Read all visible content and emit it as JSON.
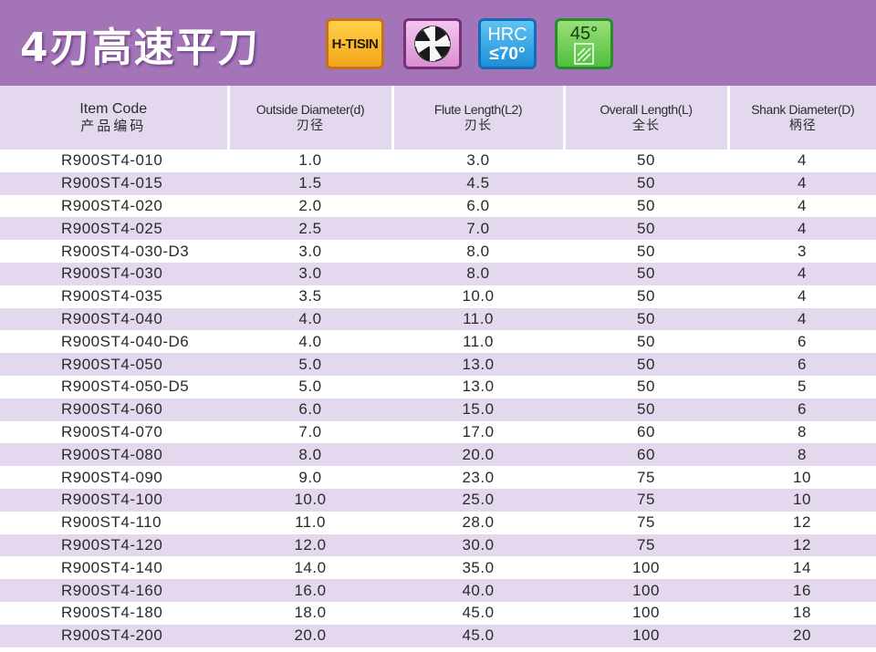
{
  "banner": {
    "title": "4刃高速平刀",
    "badges": {
      "coating": "H-TISIN",
      "flute_icon": "four-flute-icon",
      "hrc_line1": "HRC",
      "hrc_line2": "≤70°",
      "helix_line1": "45°",
      "helix_icon": "helix-angle-icon"
    }
  },
  "colors": {
    "banner": "#a374b8",
    "header_row": "#e3d8ee",
    "stripe": "#e3d8ee"
  },
  "table": {
    "columns": [
      {
        "en": "Item Code",
        "cn": "产品编码"
      },
      {
        "en": "Outside Diameter(d)",
        "cn": "刃径"
      },
      {
        "en": "Flute Length(L2)",
        "cn": "刃长"
      },
      {
        "en": "Overall Length(L)",
        "cn": "全长"
      },
      {
        "en": "Shank Diameter(D)",
        "cn": "柄径"
      }
    ],
    "rows": [
      [
        "R900ST4-010",
        "1.0",
        "3.0",
        "50",
        "4"
      ],
      [
        "R900ST4-015",
        "1.5",
        "4.5",
        "50",
        "4"
      ],
      [
        "R900ST4-020",
        "2.0",
        "6.0",
        "50",
        "4"
      ],
      [
        "R900ST4-025",
        "2.5",
        "7.0",
        "50",
        "4"
      ],
      [
        "R900ST4-030-D3",
        "3.0",
        "8.0",
        "50",
        "3"
      ],
      [
        "R900ST4-030",
        "3.0",
        "8.0",
        "50",
        "4"
      ],
      [
        "R900ST4-035",
        "3.5",
        "10.0",
        "50",
        "4"
      ],
      [
        "R900ST4-040",
        "4.0",
        "11.0",
        "50",
        "4"
      ],
      [
        "R900ST4-040-D6",
        "4.0",
        "11.0",
        "50",
        "6"
      ],
      [
        "R900ST4-050",
        "5.0",
        "13.0",
        "50",
        "6"
      ],
      [
        "R900ST4-050-D5",
        "5.0",
        "13.0",
        "50",
        "5"
      ],
      [
        "R900ST4-060",
        "6.0",
        "15.0",
        "50",
        "6"
      ],
      [
        "R900ST4-070",
        "7.0",
        "17.0",
        "60",
        "8"
      ],
      [
        "R900ST4-080",
        "8.0",
        "20.0",
        "60",
        "8"
      ],
      [
        "R900ST4-090",
        "9.0",
        "23.0",
        "75",
        "10"
      ],
      [
        "R900ST4-100",
        "10.0",
        "25.0",
        "75",
        "10"
      ],
      [
        "R900ST4-110",
        "11.0",
        "28.0",
        "75",
        "12"
      ],
      [
        "R900ST4-120",
        "12.0",
        "30.0",
        "75",
        "12"
      ],
      [
        "R900ST4-140",
        "14.0",
        "35.0",
        "100",
        "14"
      ],
      [
        "R900ST4-160",
        "16.0",
        "40.0",
        "100",
        "16"
      ],
      [
        "R900ST4-180",
        "18.0",
        "45.0",
        "100",
        "18"
      ],
      [
        "R900ST4-200",
        "20.0",
        "45.0",
        "100",
        "20"
      ]
    ]
  }
}
